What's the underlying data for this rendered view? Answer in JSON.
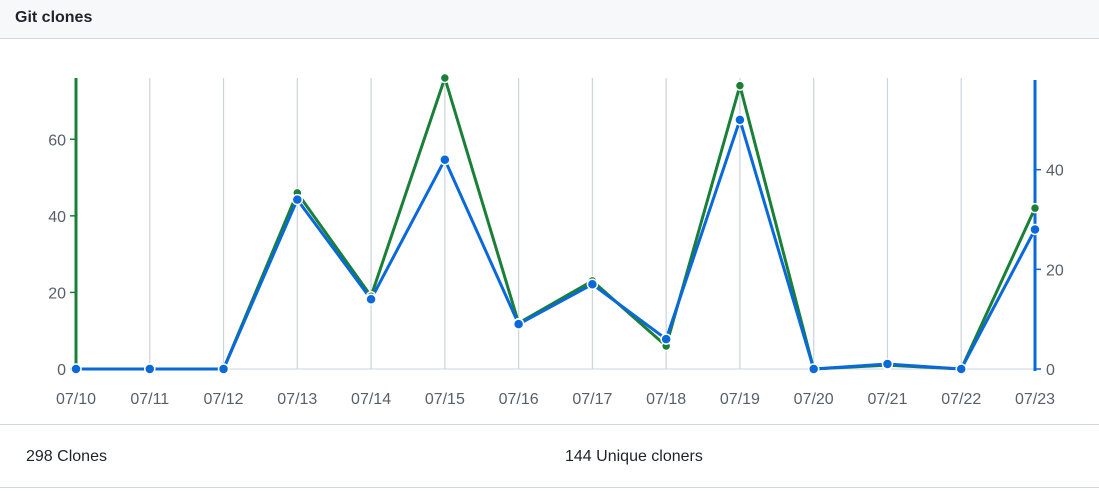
{
  "header": {
    "title": "Git clones"
  },
  "footer": {
    "clones_value": "298",
    "clones_label": "Clones",
    "unique_value": "144",
    "unique_label": "Unique cloners"
  },
  "colors": {
    "clones": "#1a7f37",
    "unique": "#0969da",
    "grid": "#ccd4dc",
    "text": "#57606a"
  },
  "chart_data": {
    "type": "line",
    "title": "",
    "xlabel": "",
    "categories": [
      "07/10",
      "07/11",
      "07/12",
      "07/13",
      "07/14",
      "07/15",
      "07/16",
      "07/17",
      "07/18",
      "07/19",
      "07/20",
      "07/21",
      "07/22",
      "07/23"
    ],
    "series": [
      {
        "axis": "left",
        "values": [
          0,
          0,
          0,
          46,
          19,
          76,
          12,
          23,
          6,
          74,
          0,
          1,
          0,
          42
        ]
      },
      {
        "axis": "right",
        "values": [
          0,
          0,
          0,
          34,
          14,
          42,
          9,
          17,
          6,
          50,
          0,
          1,
          0,
          28
        ]
      }
    ],
    "y_left": {
      "ylim": [
        0,
        76
      ],
      "ticks": [
        0,
        20,
        40,
        60
      ]
    },
    "y_right": {
      "ylim": [
        0,
        58
      ],
      "ticks": [
        0,
        20,
        40
      ]
    },
    "grid": true
  }
}
